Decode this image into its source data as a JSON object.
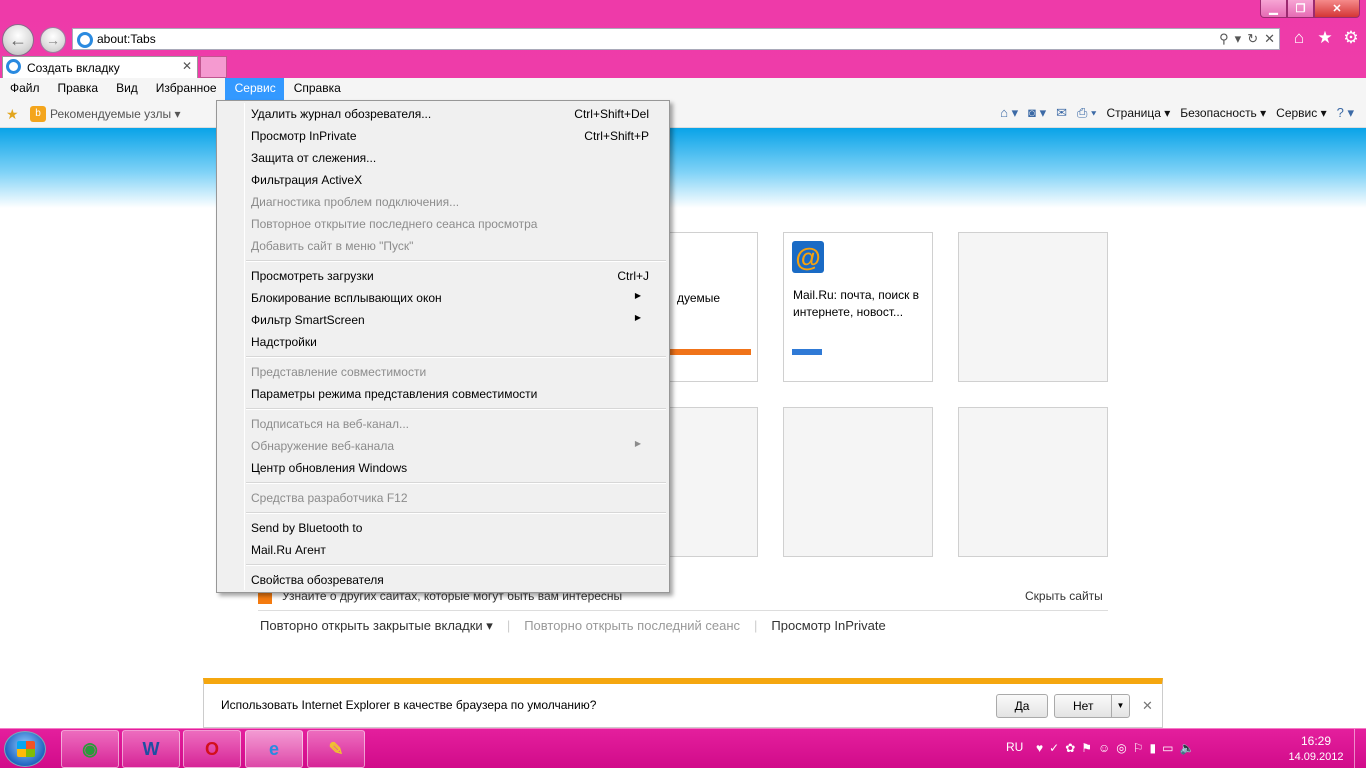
{
  "browser": {
    "address": "about:Tabs",
    "tab_title": "Создать вкладку",
    "menubar": [
      "Файл",
      "Правка",
      "Вид",
      "Избранное",
      "Сервис",
      "Справка"
    ],
    "favorites": {
      "suggested_sites": "Рекомендуемые узлы ▾"
    },
    "commandbar": {
      "page": "Страница ▾",
      "safety": "Безопасность ▾",
      "tools": "Сервис ▾"
    }
  },
  "tools_menu": {
    "items": [
      {
        "label": "Удалить журнал обозревателя...",
        "shortcut": "Ctrl+Shift+Del"
      },
      {
        "label": "Просмотр InPrivate",
        "shortcut": "Ctrl+Shift+P"
      },
      {
        "label": "Защита от слежения..."
      },
      {
        "label": "Фильтрация ActiveX"
      },
      {
        "label": "Диагностика проблем подключения..."
      },
      {
        "label": "Повторное открытие последнего сеанса просмотра"
      },
      {
        "label": "Добавить сайт в меню \"Пуск\""
      },
      {
        "label": "Просмотреть загрузки",
        "shortcut": "Ctrl+J"
      },
      {
        "label": "Блокирование всплывающих окон"
      },
      {
        "label": "Фильтр SmartScreen"
      },
      {
        "label": "Надстройки"
      },
      {
        "label": "Представление совместимости"
      },
      {
        "label": "Параметры режима представления совместимости"
      },
      {
        "label": "Подписаться на веб-канал..."
      },
      {
        "label": "Обнаружение веб-канала"
      },
      {
        "label": "Центр обновления Windows"
      },
      {
        "label": "Средства разработчика F12"
      },
      {
        "label": "Send by Bluetooth to"
      },
      {
        "label": "Mail.Ru Агент"
      },
      {
        "label": "Свойства обозревателя"
      }
    ]
  },
  "new_tab_page": {
    "tile1_text": "дуемые",
    "tile2_text": "Mail.Ru: почта, поиск в интернете, новост...",
    "tile2_icon": "@",
    "discover_text": "Узнайте о других сайтах, которые могут быть вам интересны",
    "hide_sites": "Скрыть сайты",
    "reopen_closed_tabs": "Повторно открыть закрытые вкладки ▾",
    "reopen_last_session": "Повторно открыть последний сеанс",
    "inprivate": "Просмотр InPrivate",
    "separator": "|"
  },
  "notification": {
    "text": "Использовать Internet Explorer в качестве браузера по умолчанию?",
    "yes": "Да",
    "no": "Нет"
  },
  "taskbar": {
    "lang": "RU",
    "time": "16:29",
    "date": "14.09.2012"
  },
  "colors": {
    "chrome_pink": "#ee3ca9",
    "menu_highlight": "#3399ff",
    "taskbar_pink": "#d10b8a",
    "notification_accent": "#f5a70f"
  }
}
